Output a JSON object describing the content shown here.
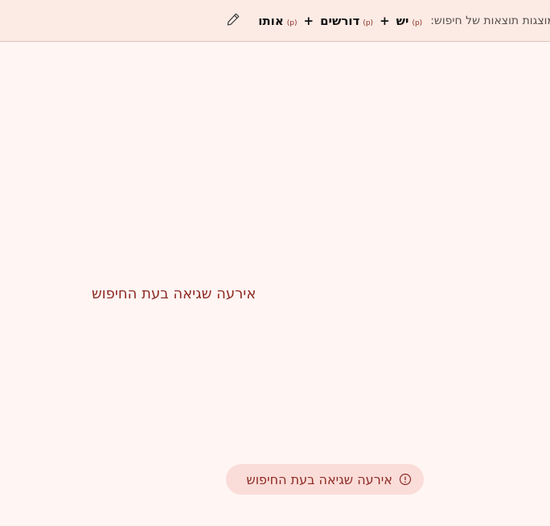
{
  "header": {
    "search_label": "מוצגות תוצאות של חיפוש:",
    "terms": [
      {
        "tag": "(p)",
        "text": "יש"
      },
      {
        "tag": "(p)",
        "text": "דורשים"
      },
      {
        "tag": "(p)",
        "text": "אותו"
      }
    ],
    "plus": "+",
    "edit_icon": "pencil-icon"
  },
  "main": {
    "error_message": "אירעה שגיאה בעת החיפוש"
  },
  "toast": {
    "icon": "info-circle-icon",
    "message": "אירעה שגיאה בעת החיפוש"
  },
  "colors": {
    "header_bg": "#fcebe5",
    "page_bg": "#fff5f3",
    "error_text": "#8e2b24",
    "toast_bg": "#fadcd8"
  }
}
